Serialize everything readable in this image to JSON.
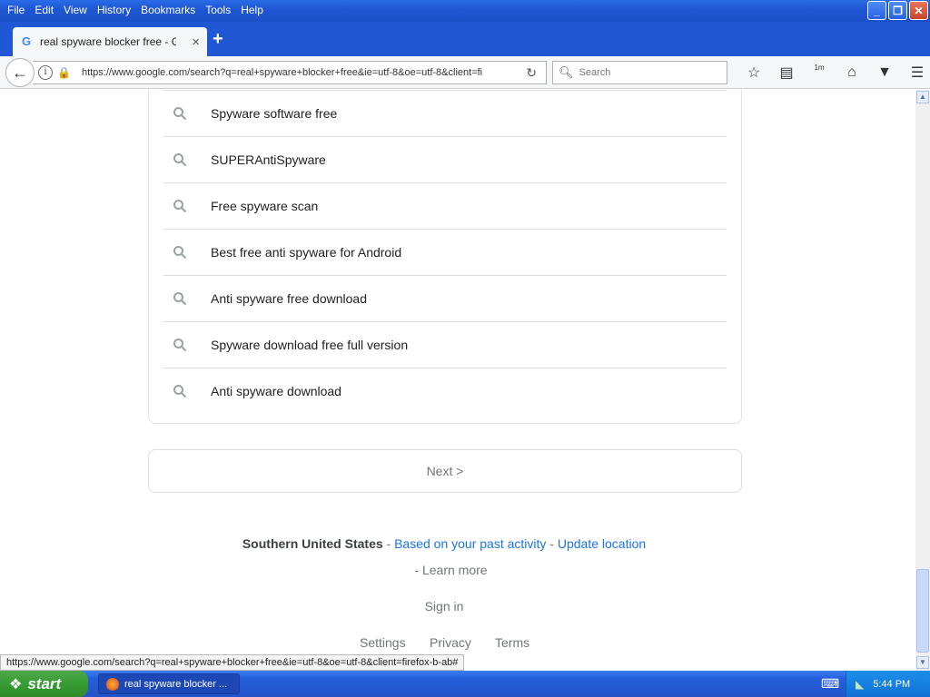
{
  "window": {
    "menu": [
      "File",
      "Edit",
      "View",
      "History",
      "Bookmarks",
      "Tools",
      "Help"
    ],
    "controls": {
      "minimize": "_",
      "restore": "❐",
      "close": "✕"
    }
  },
  "tab": {
    "title": "real spyware blocker free - G...",
    "close": "×",
    "new_tab": "+"
  },
  "navbar": {
    "url": "https://www.google.com/search?q=real+spyware+blocker+free&ie=utf-8&oe=utf-8&client=fi",
    "search_placeholder": "Search",
    "download_badge": "1m"
  },
  "related_searches": [
    "Spyware software free",
    "SUPERAntiSpyware",
    "Free spyware scan",
    "Best free anti spyware for Android",
    "Anti spyware free download",
    "Spyware download free full version",
    "Anti spyware download"
  ],
  "pagination": {
    "next": "Next >"
  },
  "footer": {
    "location": "Southern United States",
    "separator": " - ",
    "past_activity": "Based on your past activity",
    "update_location": "Update location",
    "learn_more": "- Learn more",
    "sign_in": "Sign in",
    "links": [
      "Settings",
      "Privacy",
      "Terms"
    ]
  },
  "status_bar": {
    "hover_url": "https://www.google.com/search?q=real+spyware+blocker+free&ie=utf-8&oe=utf-8&client=firefox-b-ab#"
  },
  "taskbar": {
    "start": "start",
    "task_label": "real spyware blocker ...",
    "clock": "5:44 PM"
  },
  "colors": {
    "link": "#1a73e8",
    "xp_blue": "#245edb",
    "start_green": "#379c33"
  }
}
